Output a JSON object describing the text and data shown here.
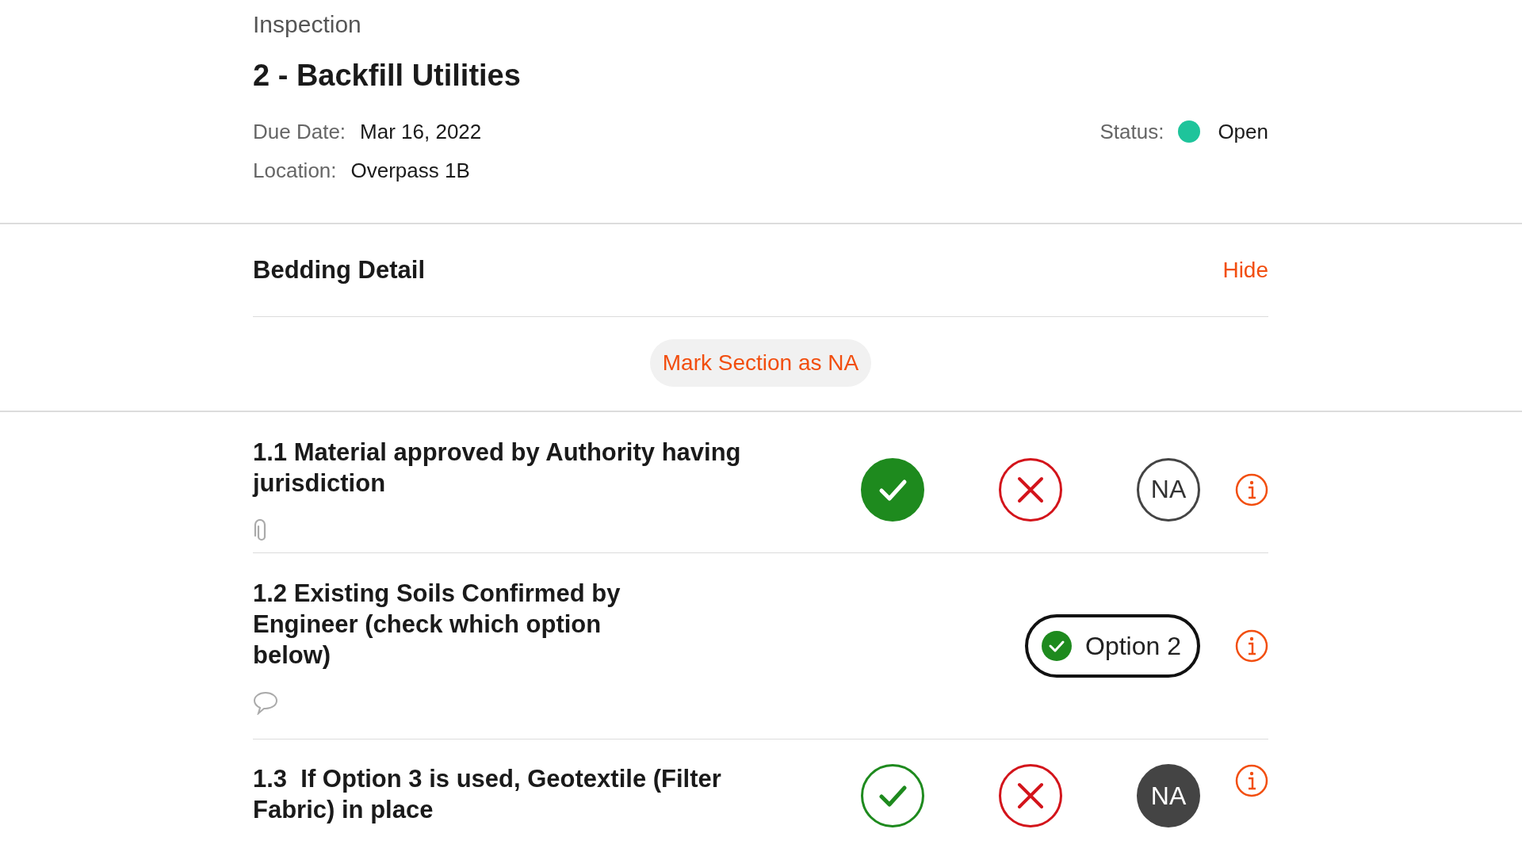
{
  "header": {
    "breadcrumb": "Inspection",
    "title": "2 - Backfill Utilities",
    "fields": [
      {
        "label": "Due Date:",
        "value": "Mar 16, 2022"
      },
      {
        "label": "Location:",
        "value": "Overpass 1B"
      }
    ],
    "status": {
      "label": "Status:",
      "value": "Open",
      "color": "#1ec49b"
    }
  },
  "section": {
    "title": "Bedding Detail",
    "toggle": "Hide",
    "mark_button": "Mark Section as NA"
  },
  "items": [
    {
      "kind": "choice",
      "text": "1.1 Material approved by Authority having jurisdiction",
      "has_attachment": true,
      "answers": [
        {
          "kind": "pass",
          "selected": true
        },
        {
          "kind": "fail",
          "selected": false
        },
        {
          "kind": "na",
          "label": "NA",
          "selected": false
        }
      ]
    },
    {
      "kind": "option",
      "text": "1.2 Existing Soils Confirmed by Engineer (check which option below)",
      "has_comment": true,
      "option": {
        "label": "Option 2",
        "checked": true
      }
    },
    {
      "kind": "choice",
      "text": "1.3  If Option 3 is used, Geotextile (Filter Fabric) in place",
      "answers": [
        {
          "kind": "pass",
          "selected": false
        },
        {
          "kind": "fail",
          "selected": false
        },
        {
          "kind": "na",
          "label": "NA",
          "selected": true
        }
      ]
    }
  ]
}
